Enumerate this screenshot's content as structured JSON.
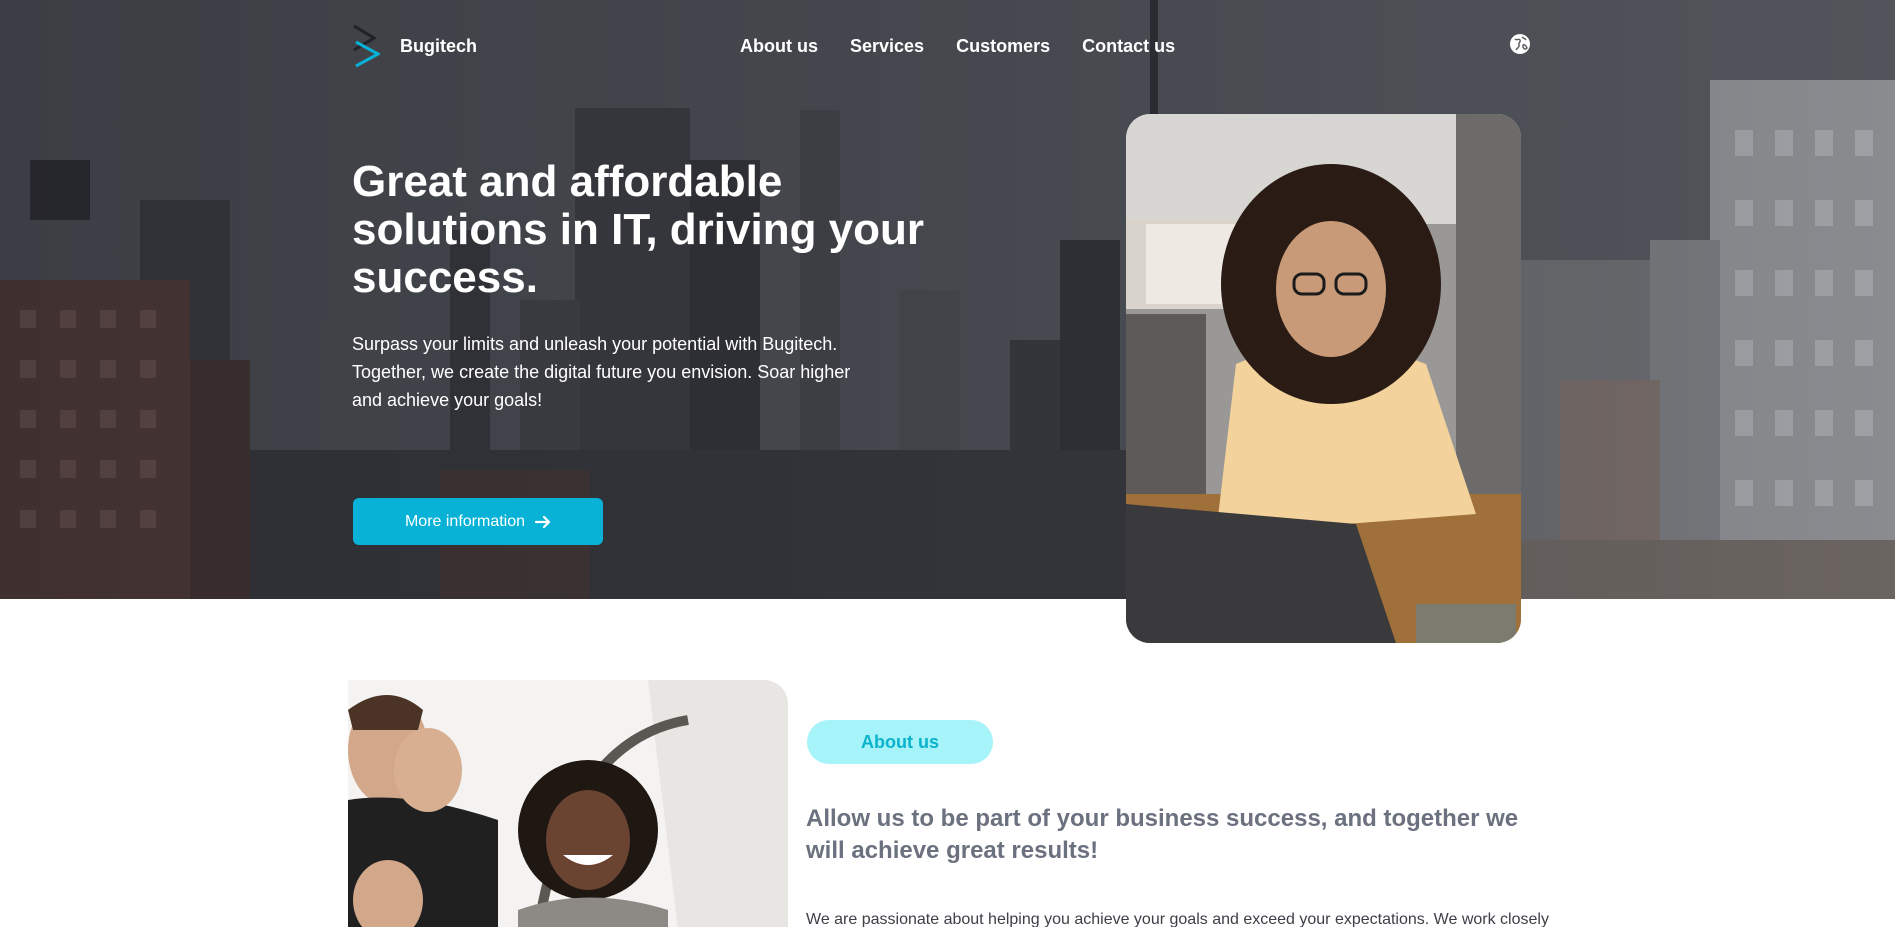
{
  "brand": {
    "name": "Bugitech",
    "colors": {
      "accent": "#07b2d6",
      "logo_dark": "#1f2229"
    }
  },
  "nav": {
    "items": [
      "About us",
      "Services",
      "Customers",
      "Contact us"
    ],
    "language_icon": "globe-icon"
  },
  "hero": {
    "title": "Great and affordable solutions in IT, driving your success.",
    "subtitle": "Surpass your limits and unleash your potential with Bugitech. Together, we create the digital future you envision. Soar higher and achieve your goals!",
    "cta_label": "More information",
    "cta_icon": "arrow-right-icon"
  },
  "about": {
    "badge": "About us",
    "heading": "Allow us to be part of your business success, and together we will achieve great results!",
    "body": "We are passionate about helping you achieve your goals and exceed your expectations. We work closely"
  }
}
